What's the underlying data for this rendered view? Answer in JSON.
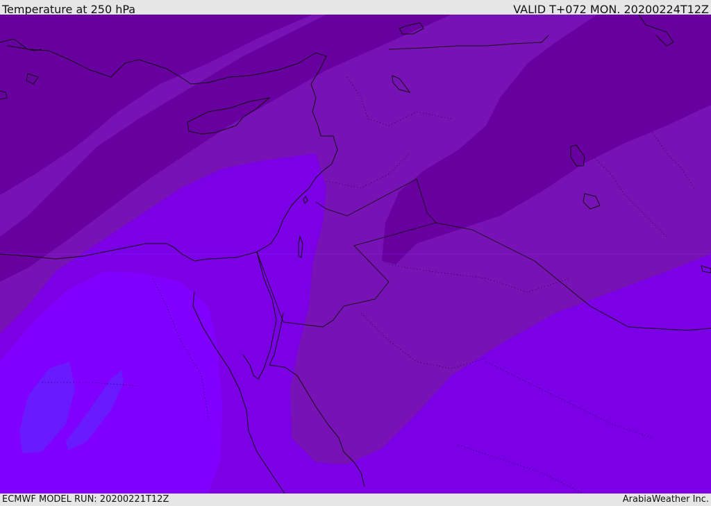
{
  "header": {
    "title": "Temperature at 250 hPa",
    "valid": "VALID T+072 MON. 20200224T12Z"
  },
  "footer": {
    "model_run": "ECMWF MODEL RUN: 20200221T12Z",
    "credit": "ArabiaWeather Inc."
  },
  "map": {
    "field": "temperature",
    "level": "250 hPa",
    "colors": {
      "band_darkest": "#6800a0",
      "band_dark": "#7712b4",
      "band_mid": "#7c00e6",
      "band_light": "#7f00ff",
      "band_blue_core": "#6a1aff",
      "coastline": "#111111"
    }
  }
}
